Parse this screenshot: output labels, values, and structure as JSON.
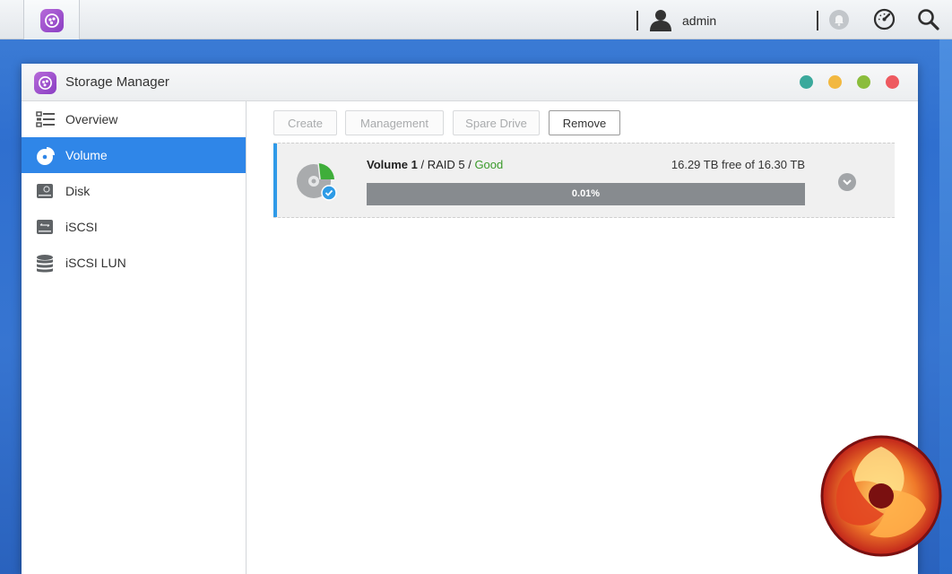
{
  "topbar": {
    "user_name": "admin",
    "icons": [
      "storage-manager-app-icon",
      "user-icon",
      "notification-icon",
      "resource-monitor-icon",
      "search-icon"
    ]
  },
  "window": {
    "title": "Storage Manager",
    "controls": {
      "colors": [
        "#3ba99c",
        "#f2b840",
        "#8bbd3c",
        "#ee5a60"
      ]
    }
  },
  "sidebar": {
    "items": [
      {
        "label": "Overview",
        "icon": "list-icon",
        "active": false
      },
      {
        "label": "Volume",
        "icon": "pie-chart-icon",
        "active": true
      },
      {
        "label": "Disk",
        "icon": "disk-icon",
        "active": false
      },
      {
        "label": "iSCSI",
        "icon": "iscsi-icon",
        "active": false
      },
      {
        "label": "iSCSI LUN",
        "icon": "database-icon",
        "active": false
      }
    ]
  },
  "toolbar": {
    "create": "Create",
    "management": "Management",
    "spare_drive": "Spare Drive",
    "remove": "Remove"
  },
  "volume": {
    "name": "Volume 1",
    "raid_prefix": " / ",
    "raid": "RAID 5",
    "status_prefix": " / ",
    "status": "Good",
    "capacity": "16.29 TB free of 16.30 TB",
    "usage_text": "0.01%",
    "usage_fraction": 0.0001
  },
  "colors": {
    "accent": "#2f86e8",
    "status_good": "#3a9a2a",
    "progress_track": "#878b8f"
  }
}
